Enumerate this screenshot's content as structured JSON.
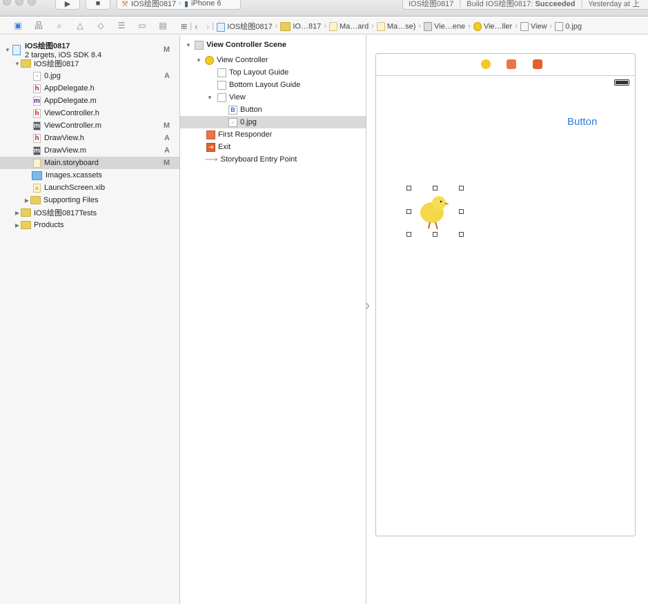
{
  "toolbar": {
    "scheme": "IOS绘图0817",
    "device": "iPhone 6",
    "status_project": "IOS绘图0817",
    "status_build": "Build IOS绘图0817:",
    "status_result": "Succeeded",
    "status_time": "Yesterday at 上"
  },
  "breadcrumbs": [
    "IOS绘图0817",
    "IO…817",
    "Ma…ard",
    "Ma…se)",
    "Vie…ene",
    "Vie…ller",
    "View",
    "0.jpg"
  ],
  "navigator": {
    "project": {
      "name": "IOS绘图0817",
      "subtitle": "2 targets, iOS SDK 8.4",
      "badge": "M"
    },
    "items": [
      {
        "label": "IOS绘图0817",
        "type": "folder",
        "badge": ""
      },
      {
        "label": "0.jpg",
        "type": "image",
        "badge": "A"
      },
      {
        "label": "AppDelegate.h",
        "type": "h",
        "badge": ""
      },
      {
        "label": "AppDelegate.m",
        "type": "m",
        "badge": ""
      },
      {
        "label": "ViewController.h",
        "type": "h",
        "badge": ""
      },
      {
        "label": "ViewController.m",
        "type": "m",
        "badge": "M"
      },
      {
        "label": "DrawView.h",
        "type": "h",
        "badge": "A"
      },
      {
        "label": "DrawView.m",
        "type": "m",
        "badge": "A"
      },
      {
        "label": "Main.storyboard",
        "type": "storyboard",
        "badge": "M"
      },
      {
        "label": "Images.xcassets",
        "type": "assets",
        "badge": ""
      },
      {
        "label": "LaunchScreen.xib",
        "type": "xib",
        "badge": ""
      },
      {
        "label": "Supporting Files",
        "type": "folder",
        "badge": ""
      },
      {
        "label": "IOS绘图0817Tests",
        "type": "folder",
        "badge": ""
      },
      {
        "label": "Products",
        "type": "folder",
        "badge": ""
      }
    ],
    "selected": "Main.storyboard"
  },
  "outline": {
    "scene": "View Controller Scene",
    "items": [
      "View Controller",
      "Top Layout Guide",
      "Bottom Layout Guide",
      "View",
      "Button",
      "0.jpg",
      "First Responder",
      "Exit",
      "Storyboard Entry Point"
    ],
    "selected": "0.jpg"
  },
  "canvas": {
    "button_label": "Button",
    "accent": "#2f7bd9"
  }
}
